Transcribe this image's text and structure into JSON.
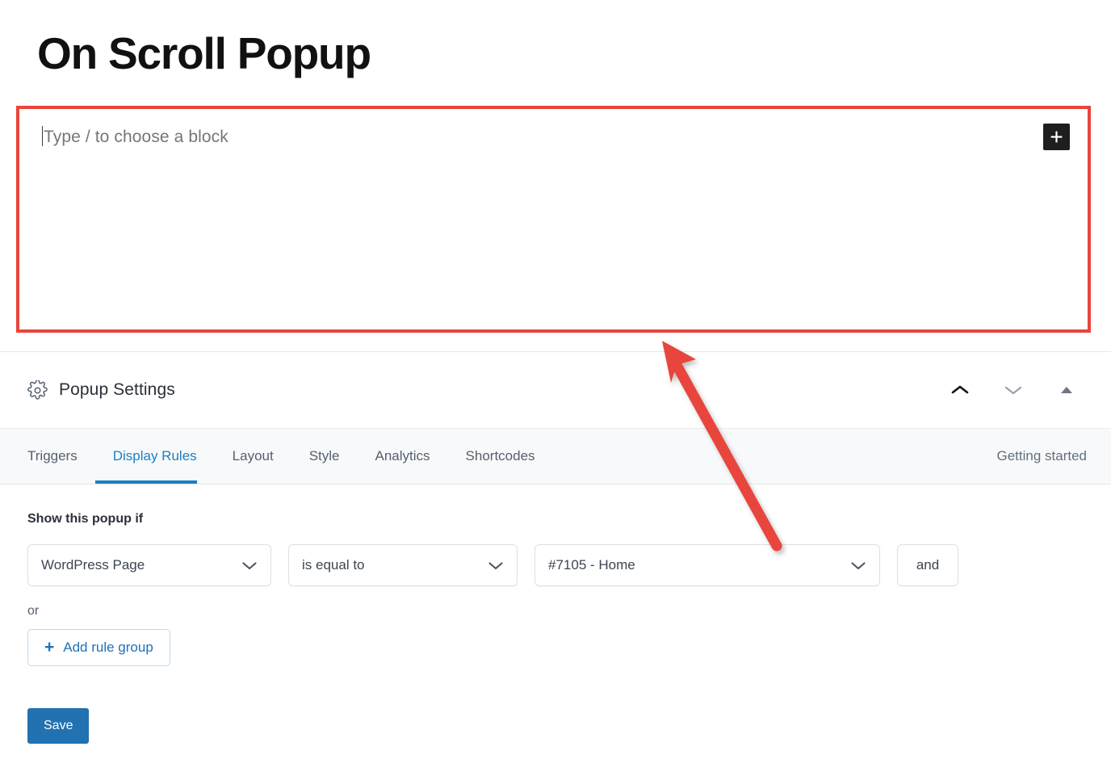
{
  "title": "On Scroll Popup",
  "editor": {
    "placeholder": "Type / to choose a block",
    "add_block_label": "+",
    "highlight_color": "#e8453c"
  },
  "settings_panel": {
    "heading": "Popup Settings",
    "icons": {
      "gear": "gear-icon",
      "move_up": "chevron-up-icon",
      "move_down": "chevron-down-icon",
      "collapse": "triangle-up-icon"
    }
  },
  "tabs": [
    {
      "label": "Triggers",
      "active": false
    },
    {
      "label": "Display Rules",
      "active": true
    },
    {
      "label": "Layout",
      "active": false
    },
    {
      "label": "Style",
      "active": false
    },
    {
      "label": "Analytics",
      "active": false
    },
    {
      "label": "Shortcodes",
      "active": false
    }
  ],
  "tabbar_right": {
    "label": "Getting started"
  },
  "rules": {
    "label": "Show this popup if",
    "row": {
      "subject": "WordPress Page",
      "operator": "is equal to",
      "value": "#7105 - Home",
      "conjunction_button": "and"
    },
    "or_label": "or",
    "add_rule_group": "Add rule group",
    "add_rule_group_plus": "+"
  },
  "actions": {
    "save": "Save"
  },
  "colors": {
    "accent_blue": "#1a80c4",
    "save_blue": "#2271b1",
    "annotation_red": "#e8453c",
    "tabbar_bg": "#f8f9fa"
  }
}
